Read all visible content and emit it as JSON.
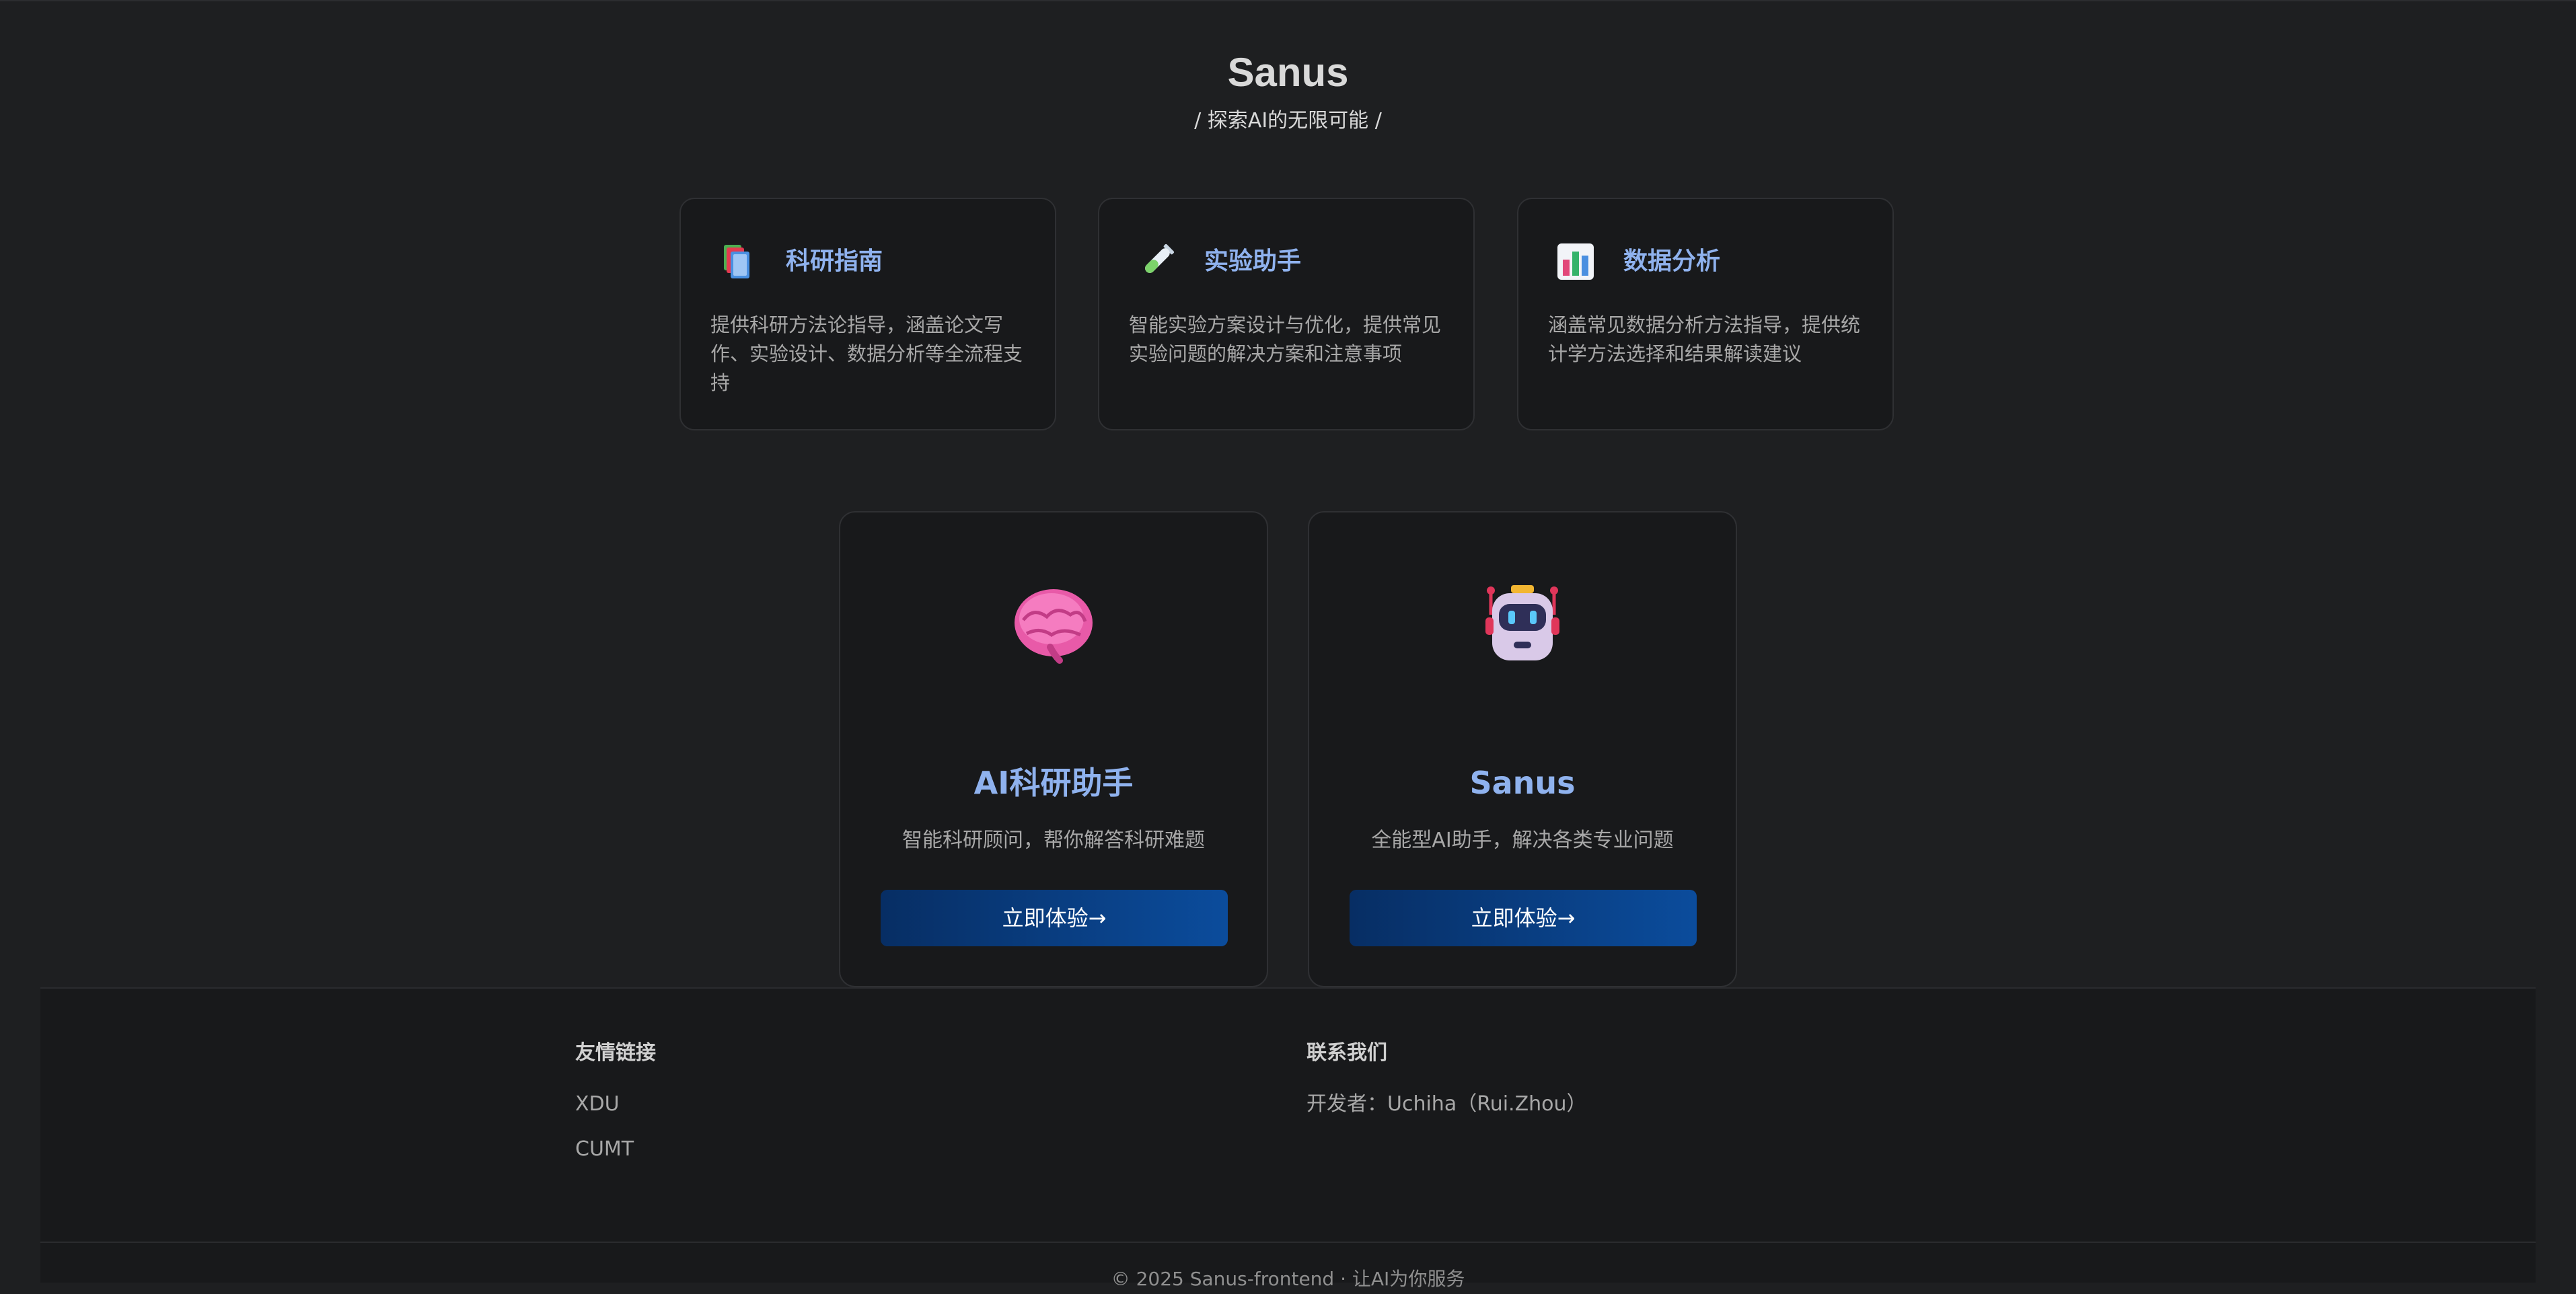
{
  "header": {
    "title": "Sanus",
    "subtitle": "/ 探索AI的无限可能 /"
  },
  "features": [
    {
      "icon": "books-icon",
      "title": "科研指南",
      "desc": "提供科研方法论指导，涵盖论文写作、实验设计、数据分析等全流程支持"
    },
    {
      "icon": "test-tube-icon",
      "title": "实验助手",
      "desc": "智能实验方案设计与优化，提供常见实验问题的解决方案和注意事项"
    },
    {
      "icon": "bar-chart-icon",
      "title": "数据分析",
      "desc": "涵盖常见数据分析方法指导，提供统计学方法选择和结果解读建议"
    }
  ],
  "apps": [
    {
      "icon": "brain-icon",
      "title": "AI科研助手",
      "desc": "智能科研顾问，帮你解答科研难题",
      "button": "立即体验→"
    },
    {
      "icon": "robot-icon",
      "title": "Sanus",
      "desc": "全能型AI助手，解决各类专业问题",
      "button": "立即体验→"
    }
  ],
  "footer": {
    "links_heading": "友情链接",
    "links": [
      "XDU",
      "CUMT"
    ],
    "contact_heading": "联系我们",
    "contact_text": "开发者：Uchiha（Rui.Zhou）",
    "copyright": "© 2025 Sanus-frontend · 让AI为你服务"
  },
  "colors": {
    "background": "#1e1f21",
    "card": "#18191b",
    "accent_text": "#8fb2ee",
    "button_start": "#072e64",
    "button_end": "#0b4c9c"
  }
}
